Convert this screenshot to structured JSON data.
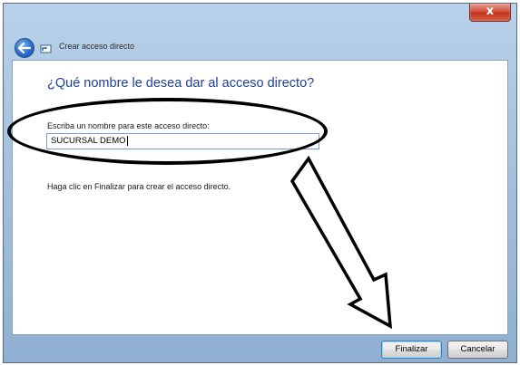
{
  "window": {
    "title": "Crear acceso directo",
    "close_label": "x"
  },
  "wizard": {
    "heading": "¿Qué nombre le desea dar al acceso directo?",
    "name_label": "Escriba un nombre para este acceso directo:",
    "name_value": "SUCURSAL DEMO",
    "hint": "Haga clic en Finalizar para crear el acceso directo."
  },
  "buttons": {
    "finish_label": "Finalizar",
    "cancel_label": "Cancelar"
  },
  "icons": {
    "back": "back-arrow-icon",
    "app": "shortcut-icon",
    "close": "close-icon"
  },
  "colors": {
    "heading": "#1e3f9e",
    "close_button": "#c3331e",
    "title_bar": "#b9d1ea"
  }
}
